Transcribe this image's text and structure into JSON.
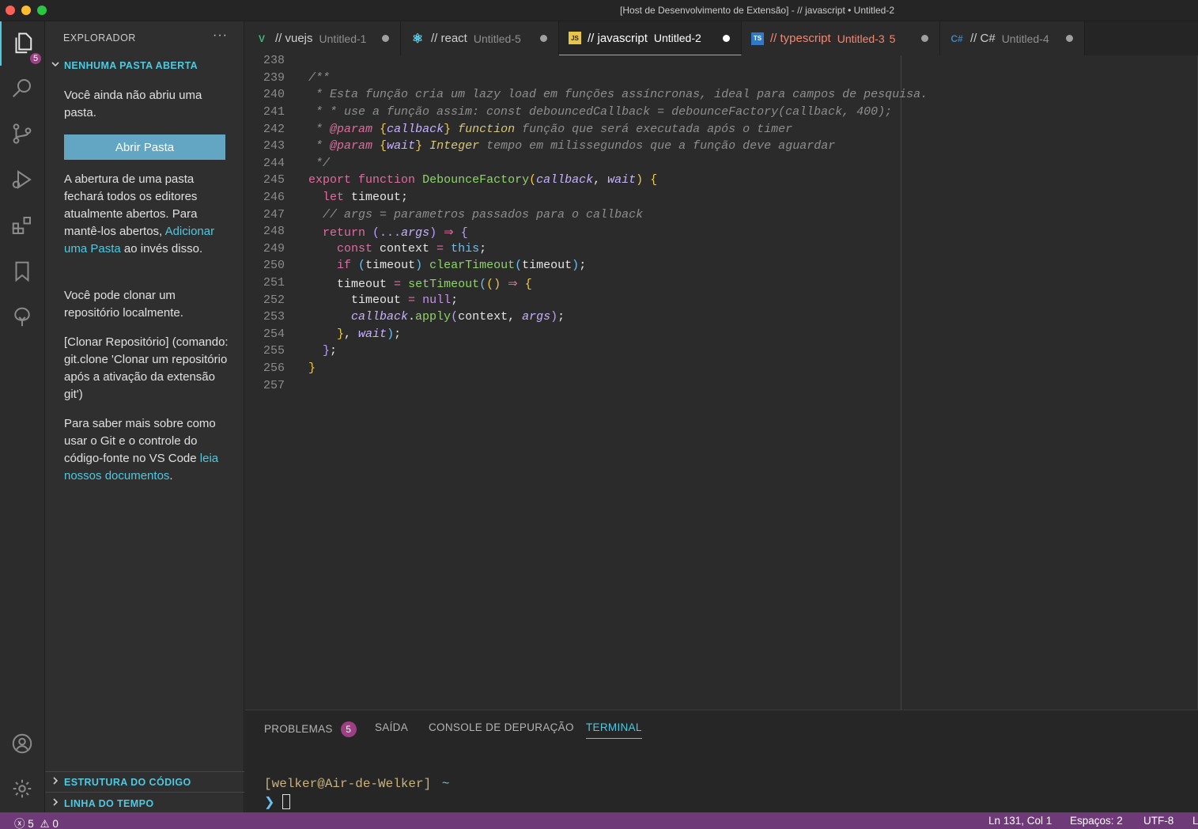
{
  "window": {
    "title": "[Host de Desenvolvimento de Extensão] - // javascript • Untitled-2"
  },
  "activity": {
    "explorer_badge": "5"
  },
  "sidebar": {
    "title": "EXPLORADOR",
    "more": "···",
    "section_open": "NENHUMA PASTA ABERTA",
    "no_folder_text": "Você ainda não abriu uma pasta.",
    "open_button": "Abrir Pasta",
    "warning_text_1": "A abertura de uma pasta fechará todos os editores atualmente abertos. Para mantê-los abertos, ",
    "warning_link": "Adicionar uma Pasta",
    "warning_text_2": " ao invés disso.",
    "clone_text": "Você pode clonar um repositório localmente.",
    "clone_command": "[Clonar Repositório] (comando: git.clone 'Clonar um repositório após a ativação da extensão git')",
    "learn_text": "Para saber mais sobre como usar o Git e o controle do código-fonte no VS Code ",
    "learn_link": "leia nossos documentos",
    "learn_end": ".",
    "section_outline": "ESTRUTURA DO CÓDIGO",
    "section_timeline": "LINHA DO TEMPO"
  },
  "tabs": [
    {
      "icon": "V",
      "icon_name": "vue-icon",
      "name": "// vuejs",
      "file": "Untitled-1",
      "color": "#41b883"
    },
    {
      "icon": "⚛",
      "icon_name": "react-icon",
      "name": "// react",
      "file": "Untitled-5",
      "color": "#61dafb"
    },
    {
      "icon": "JS",
      "icon_name": "javascript-icon",
      "name": "// javascript",
      "file": "Untitled-2",
      "color": "#e8c547"
    },
    {
      "icon": "TS",
      "icon_name": "typescript-icon",
      "name": "// typescript",
      "file": "Untitled-3",
      "count": "5",
      "color": "#3178c6"
    },
    {
      "icon": "C#",
      "icon_name": "csharp-icon",
      "name": "// C#",
      "file": "Untitled-4",
      "color": "#3b82c4"
    }
  ],
  "editor": {
    "line_numbers": [
      "238",
      "239",
      "240",
      "241",
      "242",
      "243",
      "244",
      "245",
      "246",
      "247",
      "248",
      "249",
      "250",
      "251",
      "252",
      "253",
      "254",
      "255",
      "256",
      "257"
    ]
  },
  "panel": {
    "tabs": [
      "PROBLEMAS",
      "SAÍDA",
      "CONSOLE DE DEPURAÇÃO",
      "TERMINAL"
    ],
    "problems_badge": "5",
    "prompt_user": "[welker@Air-de-Welker]",
    "prompt_path": "~",
    "prompt_symbol": "❯"
  },
  "status": {
    "errors": "5",
    "warnings": "0",
    "position": "Ln 131, Col 1",
    "spaces": "Espaços: 2",
    "encoding": "UTF-8",
    "more": "L"
  }
}
